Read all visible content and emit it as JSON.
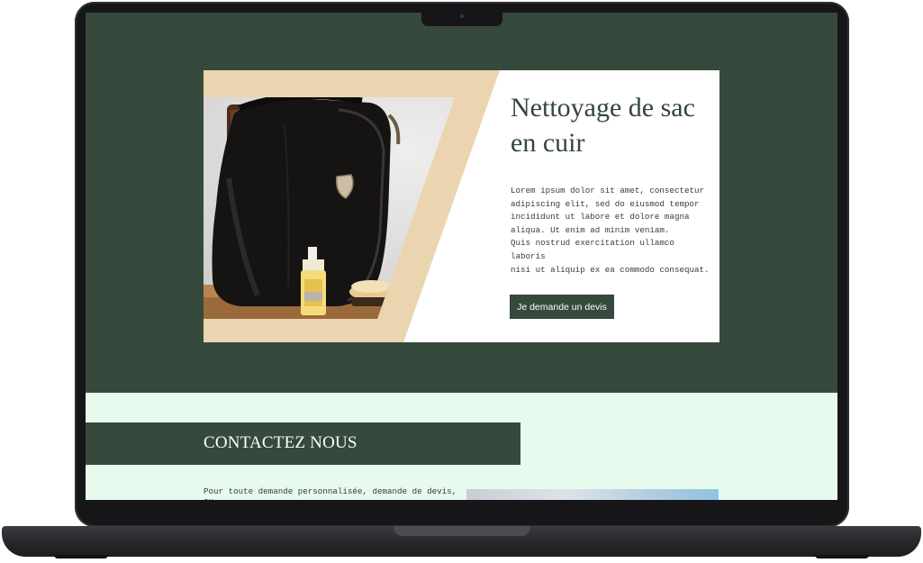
{
  "hero": {
    "title": "Nettoyage de sac en cuir",
    "paragraph_lines": [
      "Lorem ipsum dolor sit amet, consectetur",
      "adipiscing elit, sed do eiusmod tempor",
      "incididunt ut labore et dolore magna",
      "aliqua. Ut enim ad minim veniam.",
      "Quis nostrud exercitation ullamco laboris",
      "nisi ut aliquip ex ea commodo consequat."
    ],
    "button_label": "Je demande un devis",
    "image_icon": "leather-bag-photo"
  },
  "contact": {
    "title": "CONTACTEZ NOUS",
    "text": "Pour toute demande personnalisée, demande de devis, ou",
    "image_icon": "contact-photo"
  },
  "colors": {
    "primary_green": "#35493c",
    "beige_accent": "#ead5b0",
    "mint_background": "#e6faee",
    "device_frame": "#161618"
  }
}
